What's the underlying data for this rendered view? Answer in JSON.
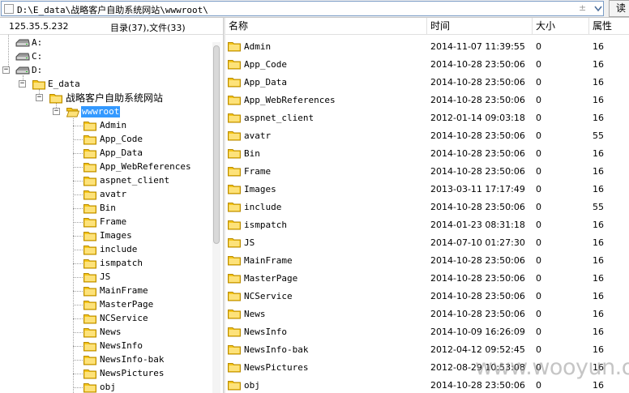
{
  "address": {
    "path": "D:\\E_data\\战略客户自助系统网站\\wwwroot\\",
    "side_label": "±",
    "read_button": "读"
  },
  "info": {
    "ip": "125.35.5.232",
    "stats": "目录(37),文件(33)"
  },
  "tree": {
    "drives": [
      "A:",
      "C:",
      "D:"
    ],
    "toggles": {
      "collapse": "−"
    },
    "e_data": "E_data",
    "site": "战略客户自助系统网站",
    "wwwroot": "wwwroot",
    "children": [
      "Admin",
      "App_Code",
      "App_Data",
      "App_WebReferences",
      "aspnet_client",
      "avatr",
      "Bin",
      "Frame",
      "Images",
      "include",
      "ismpatch",
      "JS",
      "MainFrame",
      "MasterPage",
      "NCService",
      "News",
      "NewsInfo",
      "NewsInfo-bak",
      "NewsPictures",
      "obj"
    ]
  },
  "list": {
    "columns": {
      "name": "名称",
      "time": "时间",
      "size": "大小",
      "attr": "属性"
    },
    "rows": [
      {
        "name": "Admin",
        "time": "2014-11-07 11:39:55",
        "size": "0",
        "attr": "16"
      },
      {
        "name": "App_Code",
        "time": "2014-10-28 23:50:06",
        "size": "0",
        "attr": "16"
      },
      {
        "name": "App_Data",
        "time": "2014-10-28 23:50:06",
        "size": "0",
        "attr": "16"
      },
      {
        "name": "App_WebReferences",
        "time": "2014-10-28 23:50:06",
        "size": "0",
        "attr": "16"
      },
      {
        "name": "aspnet_client",
        "time": "2012-01-14 09:03:18",
        "size": "0",
        "attr": "16"
      },
      {
        "name": "avatr",
        "time": "2014-10-28 23:50:06",
        "size": "0",
        "attr": "55"
      },
      {
        "name": "Bin",
        "time": "2014-10-28 23:50:06",
        "size": "0",
        "attr": "16"
      },
      {
        "name": "Frame",
        "time": "2014-10-28 23:50:06",
        "size": "0",
        "attr": "16"
      },
      {
        "name": "Images",
        "time": "2013-03-11 17:17:49",
        "size": "0",
        "attr": "16"
      },
      {
        "name": "include",
        "time": "2014-10-28 23:50:06",
        "size": "0",
        "attr": "55"
      },
      {
        "name": "ismpatch",
        "time": "2014-01-23 08:31:18",
        "size": "0",
        "attr": "16"
      },
      {
        "name": "JS",
        "time": "2014-07-10 01:27:30",
        "size": "0",
        "attr": "16"
      },
      {
        "name": "MainFrame",
        "time": "2014-10-28 23:50:06",
        "size": "0",
        "attr": "16"
      },
      {
        "name": "MasterPage",
        "time": "2014-10-28 23:50:06",
        "size": "0",
        "attr": "16"
      },
      {
        "name": "NCService",
        "time": "2014-10-28 23:50:06",
        "size": "0",
        "attr": "16"
      },
      {
        "name": "News",
        "time": "2014-10-28 23:50:06",
        "size": "0",
        "attr": "16"
      },
      {
        "name": "NewsInfo",
        "time": "2014-10-09 16:26:09",
        "size": "0",
        "attr": "16"
      },
      {
        "name": "NewsInfo-bak",
        "time": "2012-04-12 09:52:45",
        "size": "0",
        "attr": "16"
      },
      {
        "name": "NewsPictures",
        "time": "2012-08-29 10:53:08",
        "size": "0",
        "attr": "16"
      },
      {
        "name": "obj",
        "time": "2014-10-28 23:50:06",
        "size": "0",
        "attr": "16"
      }
    ]
  },
  "watermark": "www.wooyun.org",
  "colors": {
    "folder": "#f5c518",
    "selection": "#3399ff",
    "address_border": "#7a9cc6"
  }
}
